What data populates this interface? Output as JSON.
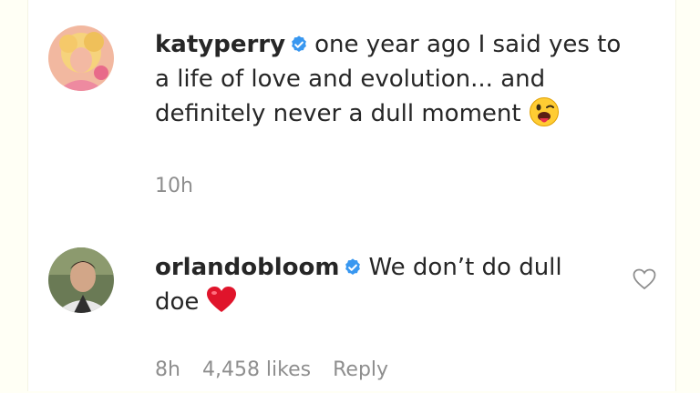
{
  "comments": [
    {
      "username": "katyperry",
      "text_line1": "one year ago I said yes to",
      "text_line2": "a life of love and evolution... and",
      "text_line3": "definitely never a dull moment",
      "emoji": "winking-face-with-tongue",
      "time": "10h"
    },
    {
      "username": "orlandobloom",
      "text_line1": "We don’t do dull",
      "text_line2": "doe",
      "emoji": "red-heart",
      "time": "8h",
      "likes": "4,458 likes",
      "reply": "Reply"
    }
  ],
  "colors": {
    "text": "#262626",
    "meta": "#8e8e8e",
    "verified": "#3897f0",
    "heart": "#e0142b"
  },
  "icons": {
    "verified": "verified-badge-icon",
    "like": "heart-outline-icon"
  }
}
